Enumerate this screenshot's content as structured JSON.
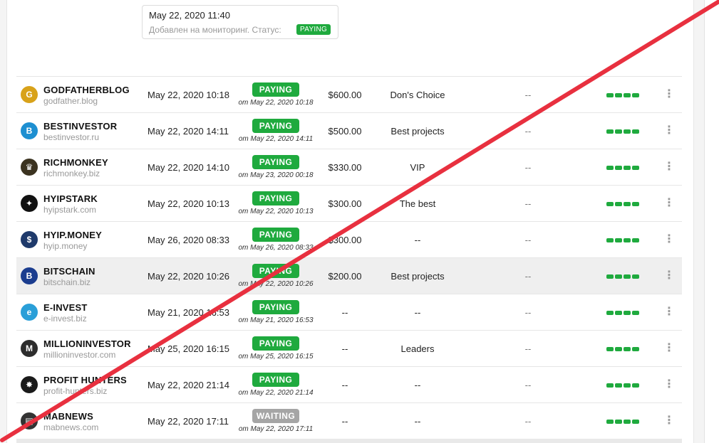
{
  "tooltip": {
    "date": "May 22, 2020 11:40",
    "message": "Добавлен на мониторинг. Статус:",
    "badge": "PAYING"
  },
  "rows": [
    {
      "name": "GODFATHERBLOG",
      "domain": "godfather.blog",
      "added": "May 22, 2020 10:18",
      "status": "PAYING",
      "since": "от May 22, 2020 10:18",
      "deposit": "$600.00",
      "plan": "Don's Choice",
      "rcb": "--",
      "logo_color": "#d8a21a",
      "logo_glyph": "G"
    },
    {
      "name": "BESTINVESTOR",
      "domain": "bestinvestor.ru",
      "added": "May 22, 2020 14:11",
      "status": "PAYING",
      "since": "от May 22, 2020 14:11",
      "deposit": "$500.00",
      "plan": "Best projects",
      "rcb": "--",
      "logo_color": "#1d8fd1",
      "logo_glyph": "B"
    },
    {
      "name": "RICHMONKEY",
      "domain": "richmonkey.biz",
      "added": "May 22, 2020 14:10",
      "status": "PAYING",
      "since": "от May 23, 2020 00:18",
      "deposit": "$330.00",
      "plan": "VIP",
      "rcb": "--",
      "logo_color": "#3b3320",
      "logo_glyph": "♛"
    },
    {
      "name": "HYIPSTARK",
      "domain": "hyipstark.com",
      "added": "May 22, 2020 10:13",
      "status": "PAYING",
      "since": "от May 22, 2020 10:13",
      "deposit": "$300.00",
      "plan": "The best",
      "rcb": "--",
      "logo_color": "#111111",
      "logo_glyph": "✦"
    },
    {
      "name": "HYIP.MONEY",
      "domain": "hyip.money",
      "added": "May 26, 2020 08:33",
      "status": "PAYING",
      "since": "от May 26, 2020 08:33",
      "deposit": "$300.00",
      "plan": "--",
      "rcb": "--",
      "logo_color": "#1f3a6b",
      "logo_glyph": "$"
    },
    {
      "name": "BITSCHAIN",
      "domain": "bitschain.biz",
      "added": "May 22, 2020 10:26",
      "status": "PAYING",
      "since": "от May 22, 2020 10:26",
      "deposit": "$200.00",
      "plan": "Best projects",
      "rcb": "--",
      "logo_color": "#1b3d8f",
      "logo_glyph": "B"
    },
    {
      "name": "E-INVEST",
      "domain": "e-invest.biz",
      "added": "May 21, 2020 16:53",
      "status": "PAYING",
      "since": "от May 21, 2020 16:53",
      "deposit": "--",
      "plan": "--",
      "rcb": "--",
      "logo_color": "#2a9fd8",
      "logo_glyph": "e"
    },
    {
      "name": "MILLIONINVESTOR",
      "domain": "millioninvestor.com",
      "added": "May 25, 2020 16:15",
      "status": "PAYING",
      "since": "от May 25, 2020 16:15",
      "deposit": "--",
      "plan": "Leaders",
      "rcb": "--",
      "logo_color": "#2d2d2d",
      "logo_glyph": "M"
    },
    {
      "name": "PROFIT HUNTERS",
      "domain": "profit-hunters.biz",
      "added": "May 22, 2020 21:14",
      "status": "PAYING",
      "since": "от May 22, 2020 21:14",
      "deposit": "--",
      "plan": "--",
      "rcb": "--",
      "logo_color": "#1a1a1a",
      "logo_glyph": "✸"
    },
    {
      "name": "MABNEWS",
      "domain": "mabnews.com",
      "added": "May 22, 2020 17:11",
      "status": "WAITING",
      "since": "от May 22, 2020 17:11",
      "deposit": "--",
      "plan": "--",
      "rcb": "--",
      "logo_color": "#333333",
      "logo_glyph": "▤"
    }
  ],
  "colors": {
    "paying": "#1faa3e",
    "waiting": "#a5a5a5",
    "cross": "#e8303f"
  }
}
